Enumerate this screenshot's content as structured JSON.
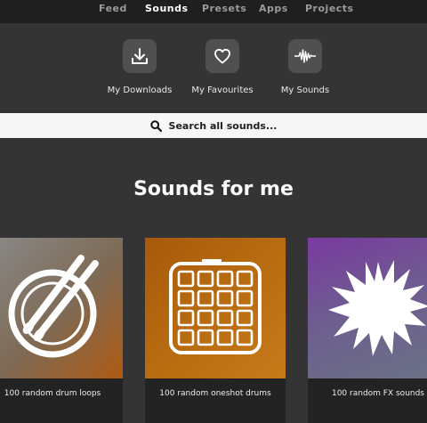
{
  "nav": {
    "tabs": [
      "Feed",
      "Sounds",
      "Presets",
      "Apps",
      "Projects"
    ],
    "active": "Sounds"
  },
  "shortcuts": [
    {
      "label": "My Downloads",
      "icon": "download-icon"
    },
    {
      "label": "My Favourites",
      "icon": "heart-icon"
    },
    {
      "label": "My Sounds",
      "icon": "waveform-icon"
    }
  ],
  "search": {
    "placeholder": "Search all sounds..."
  },
  "section": {
    "title": "Sounds for me"
  },
  "cards": [
    {
      "caption": "100 random drum loops",
      "icon": "drumsticks-icon"
    },
    {
      "caption": "100 random oneshot drums",
      "icon": "drum-pad-icon"
    },
    {
      "caption": "100 random FX sounds",
      "icon": "fx-splash-icon"
    }
  ],
  "colors": {
    "background": "#343434",
    "nav_background": "#1f1f1f",
    "search_background": "#f6f6f6",
    "icon_tile": "#505050"
  }
}
